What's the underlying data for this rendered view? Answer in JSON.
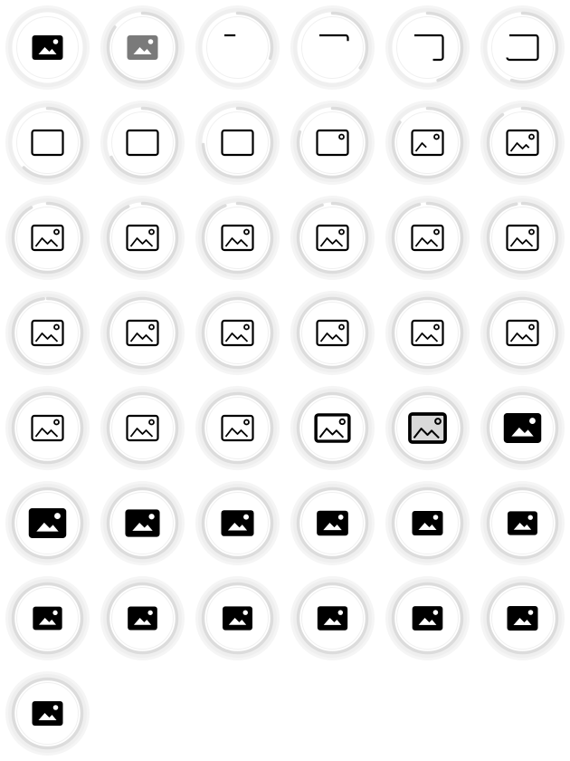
{
  "sheet": {
    "description_free": true,
    "columns": 6,
    "accent": "#000000",
    "ring_color": "#dcdcdc",
    "icon": "image-icon",
    "frames": [
      {
        "progress": 1.0,
        "stage": "filled",
        "outline": 0,
        "ring": 0.0,
        "gray": false
      },
      {
        "progress": 1.0,
        "stage": "filled",
        "outline": 0,
        "ring": 0.85,
        "gray": true
      },
      {
        "progress": 0.05,
        "stage": "outline",
        "outline": 0.1,
        "ring": 0.3
      },
      {
        "progress": 0.1,
        "stage": "outline",
        "outline": 0.3,
        "ring": 0.35
      },
      {
        "progress": 0.15,
        "stage": "outline",
        "outline": 0.55,
        "ring": 0.45
      },
      {
        "progress": 0.2,
        "stage": "outline",
        "outline": 0.75,
        "ring": 0.55
      },
      {
        "progress": 0.25,
        "stage": "outline",
        "outline": 1.0,
        "ring": 0.62
      },
      {
        "progress": 0.3,
        "stage": "outline",
        "outline": 1.0,
        "ring": 0.68
      },
      {
        "progress": 0.35,
        "stage": "outline",
        "outline": 1.0,
        "ring": 0.74
      },
      {
        "progress": 0.4,
        "stage": "outline",
        "outline": 1.0,
        "ring": 0.8,
        "sun": true
      },
      {
        "progress": 0.45,
        "stage": "outline",
        "outline": 1.0,
        "ring": 0.85,
        "sun": true,
        "mountain": 0.3
      },
      {
        "progress": 0.5,
        "stage": "outline",
        "outline": 1.0,
        "ring": 0.9,
        "sun": true,
        "mountain": 0.5
      },
      {
        "progress": 0.55,
        "stage": "outline",
        "outline": 1.0,
        "ring": 0.92,
        "sun": true,
        "mountain": 0.7
      },
      {
        "progress": 0.6,
        "stage": "outline",
        "outline": 1.0,
        "ring": 0.93,
        "sun": true,
        "mountain": 1.0
      },
      {
        "progress": 0.62,
        "stage": "outline",
        "outline": 1.0,
        "ring": 0.94,
        "sun": true,
        "mountain": 1.0
      },
      {
        "progress": 0.64,
        "stage": "outline",
        "outline": 1.0,
        "ring": 0.95,
        "sun": true,
        "mountain": 1.0
      },
      {
        "progress": 0.66,
        "stage": "outline",
        "outline": 1.0,
        "ring": 0.96,
        "sun": true,
        "mountain": 1.0
      },
      {
        "progress": 0.68,
        "stage": "outline",
        "outline": 1.0,
        "ring": 0.97,
        "sun": true,
        "mountain": 1.0
      },
      {
        "progress": 0.7,
        "stage": "outline",
        "outline": 1.0,
        "ring": 0.98,
        "sun": true,
        "mountain": 1.0
      },
      {
        "progress": 0.72,
        "stage": "outline",
        "outline": 1.0,
        "ring": 1.0,
        "sun": true,
        "mountain": 1.0
      },
      {
        "progress": 0.74,
        "stage": "outline",
        "outline": 1.0,
        "ring": 1.0,
        "sun": true,
        "mountain": 1.0
      },
      {
        "progress": 0.76,
        "stage": "outline",
        "outline": 1.0,
        "ring": 1.0,
        "sun": true,
        "mountain": 1.0
      },
      {
        "progress": 0.78,
        "stage": "outline",
        "outline": 1.0,
        "ring": 1.0,
        "sun": true,
        "mountain": 1.0
      },
      {
        "progress": 0.8,
        "stage": "outline",
        "outline": 1.0,
        "ring": 1.0,
        "sun": true,
        "mountain": 1.0
      },
      {
        "progress": 0.82,
        "stage": "outline",
        "outline": 1.0,
        "ring": 1.0,
        "sun": true,
        "mountain": 1.0
      },
      {
        "progress": 0.84,
        "stage": "outline",
        "outline": 1.0,
        "ring": 1.0,
        "sun": true,
        "mountain": 1.0
      },
      {
        "progress": 0.86,
        "stage": "outline",
        "outline": 1.0,
        "ring": 1.0,
        "sun": true,
        "mountain": 1.0
      },
      {
        "progress": 0.88,
        "stage": "thick",
        "outline": 1.0,
        "ring": 1.0,
        "sun": true,
        "mountain": 1.0,
        "scale": 1.08
      },
      {
        "progress": 0.9,
        "stage": "thick",
        "outline": 1.0,
        "ring": 1.0,
        "sun": true,
        "mountain": 1.0,
        "scale": 1.15,
        "fill": 0.5
      },
      {
        "progress": 0.92,
        "stage": "filled",
        "outline": 1.0,
        "ring": 1.0,
        "scale": 1.22
      },
      {
        "progress": 0.93,
        "stage": "filled",
        "outline": 1.0,
        "ring": 1.0,
        "scale": 1.22
      },
      {
        "progress": 0.94,
        "stage": "filled",
        "outline": 1.0,
        "ring": 1.0,
        "scale": 1.12
      },
      {
        "progress": 0.95,
        "stage": "filled",
        "outline": 1.0,
        "ring": 1.0,
        "scale": 1.06
      },
      {
        "progress": 0.96,
        "stage": "filled",
        "outline": 1.0,
        "ring": 1.0,
        "scale": 1.02
      },
      {
        "progress": 0.97,
        "stage": "filled",
        "outline": 1.0,
        "ring": 1.0,
        "scale": 1.0
      },
      {
        "progress": 0.98,
        "stage": "filled",
        "outline": 1.0,
        "ring": 1.0,
        "scale": 0.97
      },
      {
        "progress": 0.985,
        "stage": "filled",
        "outline": 1.0,
        "ring": 1.0,
        "scale": 0.95
      },
      {
        "progress": 0.99,
        "stage": "filled",
        "outline": 1.0,
        "ring": 1.0,
        "scale": 0.96
      },
      {
        "progress": 0.992,
        "stage": "filled",
        "outline": 1.0,
        "ring": 1.0,
        "scale": 0.97
      },
      {
        "progress": 0.994,
        "stage": "filled",
        "outline": 1.0,
        "ring": 1.0,
        "scale": 0.98
      },
      {
        "progress": 0.996,
        "stage": "filled",
        "outline": 1.0,
        "ring": 1.0,
        "scale": 0.99
      },
      {
        "progress": 0.998,
        "stage": "filled",
        "outline": 1.0,
        "ring": 1.0,
        "scale": 1.0
      },
      {
        "progress": 1.0,
        "stage": "filled",
        "outline": 1.0,
        "ring": 1.0,
        "scale": 1.0
      }
    ]
  }
}
